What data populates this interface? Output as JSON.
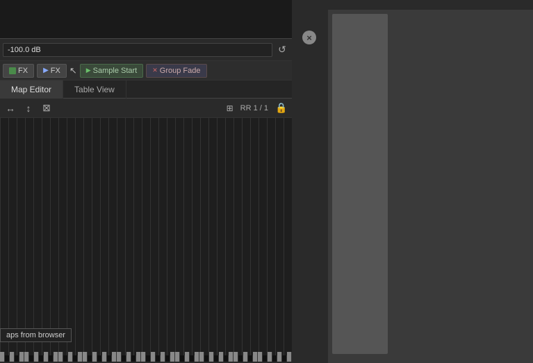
{
  "topArea": {
    "background": "#1a1a1a"
  },
  "closeBtn": {
    "label": "×"
  },
  "volumeRow": {
    "value": "-100.0 dB",
    "resetIcon": "↺"
  },
  "fxRow": {
    "fx1Label": "FX",
    "fx2Label": "FX",
    "sampleStartLabel": "Sample Start",
    "groupFadeLabel": "Group Fade"
  },
  "tabs": [
    {
      "label": "Map Editor",
      "active": true
    },
    {
      "label": "Table View",
      "active": false
    }
  ],
  "toolbar": {
    "rrLabel": "RR 1 / 1",
    "tools": [
      "↔",
      "↕",
      "⊠"
    ],
    "lockIcon": "🔒"
  },
  "tooltip": {
    "text": "aps from browser"
  },
  "rightPanel": {
    "background": "#3a3a3a"
  }
}
